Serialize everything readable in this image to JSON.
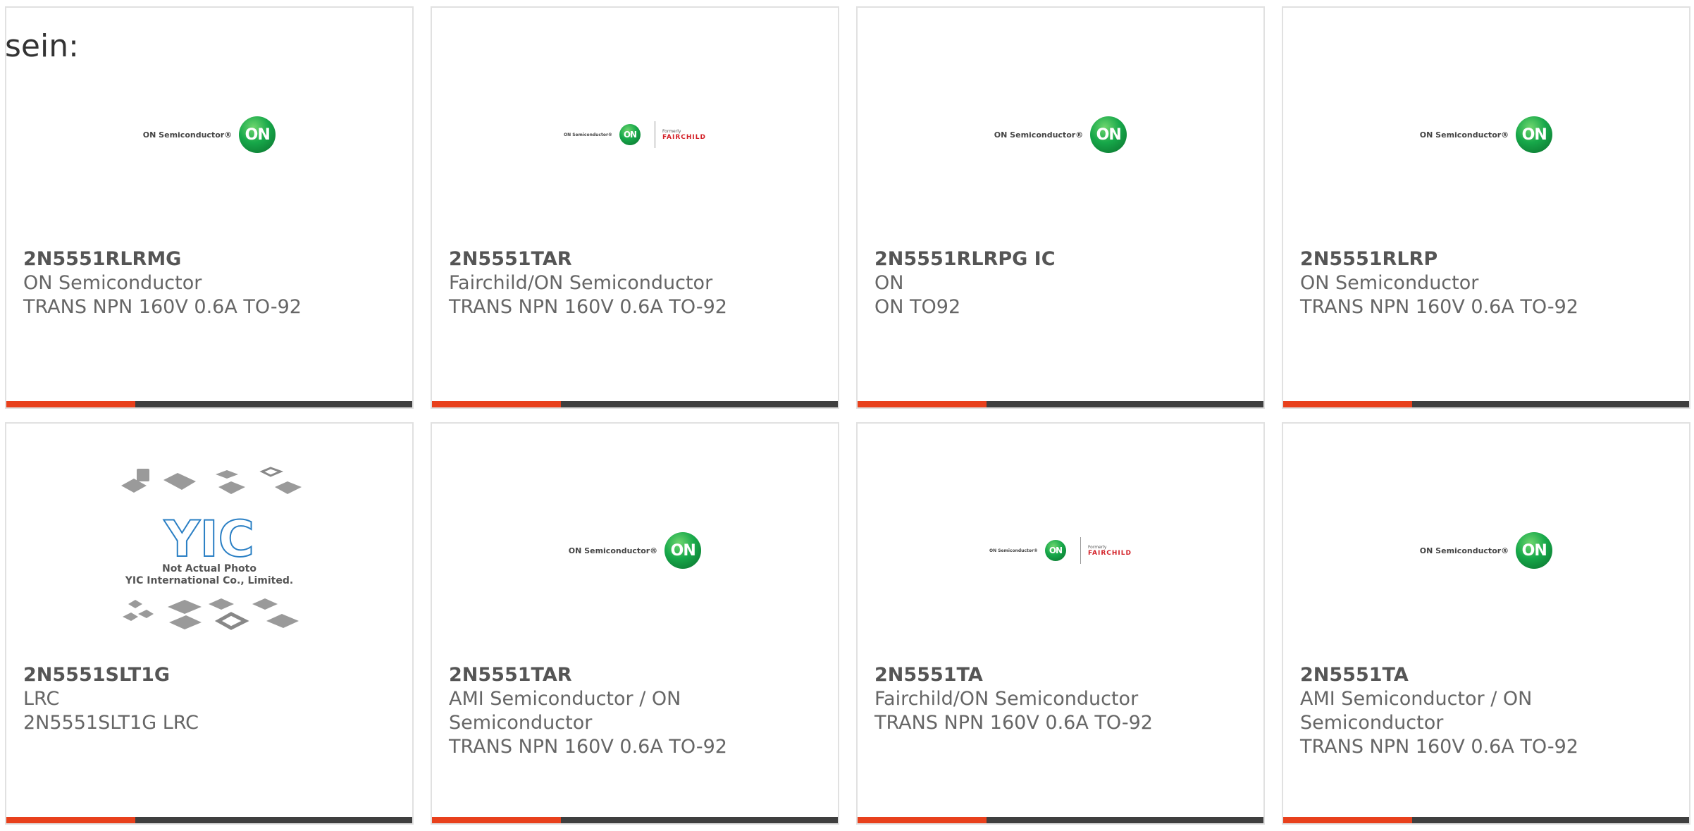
{
  "lead_text": "sein:",
  "colors": {
    "accent": "#e8401c",
    "bar": "#3f3f3f",
    "card_border": "#e1e1e1",
    "on_green": "#17a84a",
    "fairchild_red": "#d32027"
  },
  "logos": {
    "on_text": "ON Semiconductor®",
    "on_badge": "ON",
    "fairchild_formerly": "Formerly",
    "fairchild_name": "FAIRCHILD",
    "yic_name": "YIC",
    "yic_note_1": "Not Actual Photo",
    "yic_note_2": "YIC International Co., Limited."
  },
  "products": [
    {
      "logo": "on-semiconductor-logo",
      "part": "2N5551RLRMG",
      "manufacturer": "ON Semiconductor",
      "description": "TRANS NPN 160V 0.6A TO-92"
    },
    {
      "logo": "on-fairchild-logo",
      "part": "2N5551TAR",
      "manufacturer": "Fairchild/ON Semiconductor",
      "description": "TRANS NPN 160V 0.6A TO-92"
    },
    {
      "logo": "on-semiconductor-logo",
      "part": "2N5551RLRPG IC",
      "manufacturer": "ON",
      "description": "ON TO92"
    },
    {
      "logo": "on-semiconductor-logo",
      "part": "2N5551RLRP",
      "manufacturer": "ON Semiconductor",
      "description": "TRANS NPN 160V 0.6A TO-92"
    },
    {
      "logo": "yic-placeholder-image",
      "part": "2N5551SLT1G",
      "manufacturer": "LRC",
      "description": "2N5551SLT1G LRC"
    },
    {
      "logo": "on-semiconductor-logo",
      "part": "2N5551TAR",
      "manufacturer": "AMI Semiconductor / ON Semiconductor",
      "description": "TRANS NPN 160V 0.6A TO-92"
    },
    {
      "logo": "on-fairchild-logo",
      "part": "2N5551TA",
      "manufacturer": "Fairchild/ON Semiconductor",
      "description": "TRANS NPN 160V 0.6A TO-92"
    },
    {
      "logo": "on-semiconductor-logo",
      "part": "2N5551TA",
      "manufacturer": "AMI Semiconductor / ON Semiconductor",
      "description": "TRANS NPN 160V 0.6A TO-92"
    }
  ]
}
